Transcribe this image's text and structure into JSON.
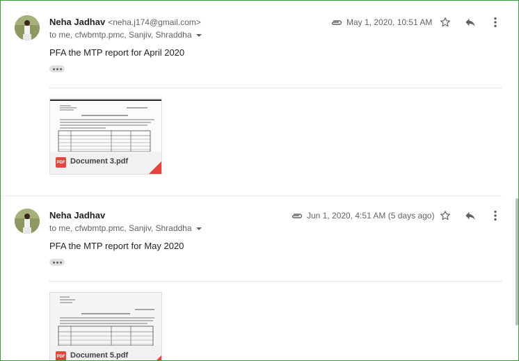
{
  "messages": [
    {
      "sender_name": "Neha Jadhav",
      "sender_email": "<neha.j174@gmail.com>",
      "recipients": "to me, cfwbmtp.pmc, Sanjiv, Shraddha",
      "date": "May 1, 2020, 10:51 AM",
      "body": "PFA the MTP report for April 2020",
      "attachment": {
        "type": "PDF",
        "name": "Document 3.pdf"
      }
    },
    {
      "sender_name": "Neha Jadhav",
      "sender_email": "",
      "recipients": "to me, cfwbmtp.pmc, Sanjiv, Shraddha",
      "date": "Jun 1, 2020, 4:51 AM (5 days ago)",
      "body": "PFA the MTP report for May 2020",
      "attachment": {
        "type": "PDF",
        "name": "Document 5.pdf"
      }
    }
  ],
  "icons": {
    "attachment": "paperclip-icon",
    "star": "star-icon",
    "reply": "reply-icon",
    "more": "more-vertical-icon",
    "expand": "chevron-down-icon",
    "trimmed": "ellipsis-icon"
  },
  "colors": {
    "pdf_red": "#e2463a",
    "frame_green": "#3c9a3c",
    "secondary_text": "#5f6368"
  }
}
